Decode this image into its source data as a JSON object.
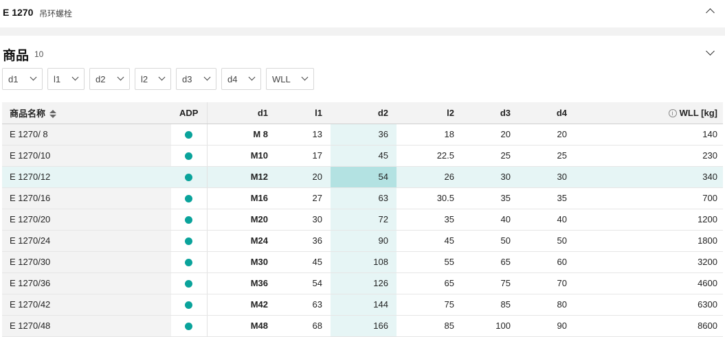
{
  "header": {
    "title": "E 1270",
    "subtitle": "吊环螺栓"
  },
  "section": {
    "title": "商品",
    "count": "10"
  },
  "filters": [
    {
      "label": "d1"
    },
    {
      "label": "l1"
    },
    {
      "label": "d2"
    },
    {
      "label": "l2"
    },
    {
      "label": "d3"
    },
    {
      "label": "d4"
    },
    {
      "label": "WLL"
    }
  ],
  "table": {
    "columns": {
      "name": "商品名称",
      "adp": "ADP",
      "d1": "d1",
      "l1": "l1",
      "d2": "d2",
      "l2": "l2",
      "d3": "d3",
      "d4": "d4",
      "wll": "WLL [kg]"
    },
    "info_glyph": "i",
    "adp_color": "#0aa39b",
    "highlight_color": "#e6f5f5",
    "rows": [
      {
        "name": "E 1270/ 8",
        "d1": "M 8",
        "l1": "13",
        "d2": "36",
        "l2": "18",
        "d3": "20",
        "d4": "20",
        "wll": "140"
      },
      {
        "name": "E 1270/10",
        "d1": "M10",
        "l1": "17",
        "d2": "45",
        "l2": "22.5",
        "d3": "25",
        "d4": "25",
        "wll": "230"
      },
      {
        "name": "E 1270/12",
        "d1": "M12",
        "l1": "20",
        "d2": "54",
        "l2": "26",
        "d3": "30",
        "d4": "30",
        "wll": "340"
      },
      {
        "name": "E 1270/16",
        "d1": "M16",
        "l1": "27",
        "d2": "63",
        "l2": "30.5",
        "d3": "35",
        "d4": "35",
        "wll": "700"
      },
      {
        "name": "E 1270/20",
        "d1": "M20",
        "l1": "30",
        "d2": "72",
        "l2": "35",
        "d3": "40",
        "d4": "40",
        "wll": "1200"
      },
      {
        "name": "E 1270/24",
        "d1": "M24",
        "l1": "36",
        "d2": "90",
        "l2": "45",
        "d3": "50",
        "d4": "50",
        "wll": "1800"
      },
      {
        "name": "E 1270/30",
        "d1": "M30",
        "l1": "45",
        "d2": "108",
        "l2": "55",
        "d3": "65",
        "d4": "60",
        "wll": "3200"
      },
      {
        "name": "E 1270/36",
        "d1": "M36",
        "l1": "54",
        "d2": "126",
        "l2": "65",
        "d3": "75",
        "d4": "70",
        "wll": "4600"
      },
      {
        "name": "E 1270/42",
        "d1": "M42",
        "l1": "63",
        "d2": "144",
        "l2": "75",
        "d3": "85",
        "d4": "80",
        "wll": "6300"
      },
      {
        "name": "E 1270/48",
        "d1": "M48",
        "l1": "68",
        "d2": "166",
        "l2": "85",
        "d3": "100",
        "d4": "90",
        "wll": "8600"
      }
    ]
  }
}
